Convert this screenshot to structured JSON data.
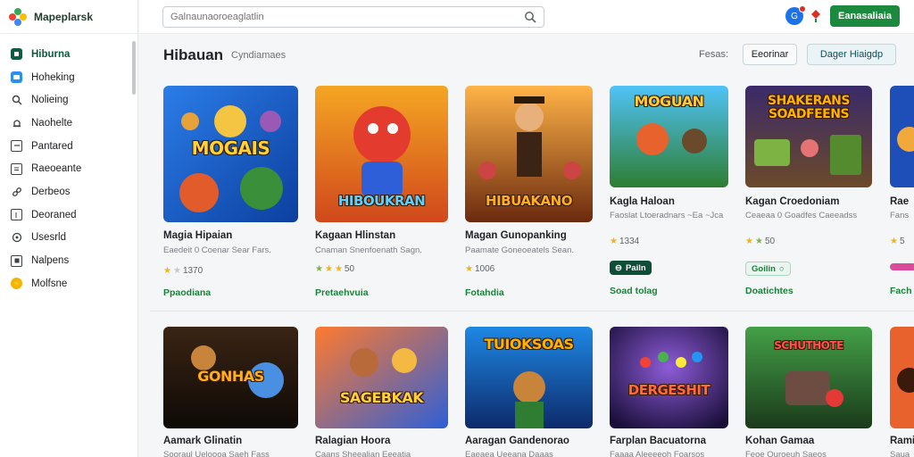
{
  "app": {
    "brand": "Mapeplarsk"
  },
  "sidebar": {
    "items": [
      {
        "label": "Hiburna",
        "icon": "home-icon",
        "active": true
      },
      {
        "label": "Hoheking",
        "icon": "chat-icon"
      },
      {
        "label": "Nolieing",
        "icon": "search-icon"
      },
      {
        "label": "Naohelte",
        "icon": "bell-icon"
      },
      {
        "label": "Pantared",
        "icon": "calendar-icon"
      },
      {
        "label": "Raeoeante",
        "icon": "document-icon"
      },
      {
        "label": "Derbeos",
        "icon": "link-icon"
      },
      {
        "label": "Deoraned",
        "icon": "bookmark-icon"
      },
      {
        "label": "Usesrld",
        "icon": "settings-icon"
      },
      {
        "label": "Nalpens",
        "icon": "grid-icon"
      },
      {
        "label": "Molfsne",
        "icon": "star-icon"
      }
    ]
  },
  "search": {
    "placeholder": "Galnaunaoroeaglatlin"
  },
  "topbar": {
    "cta_label": "Eanasaliaia",
    "avatar_initial": "G"
  },
  "header": {
    "title": "Hibauan",
    "subtitle": "Cyndiamaes",
    "sort_label": "Fesas:",
    "btn1": "Eeorinar",
    "btn2": "Dager Hiaigdp"
  },
  "row1": [
    {
      "thumb_title": "MOGAIS",
      "name": "Magia Hipaian",
      "desc": "Eaedeit 0 Coenar Sear Fars.",
      "rating": "1370",
      "link": "Ppaodiana"
    },
    {
      "thumb_title": "HIBOUKRAN",
      "name": "Kagaan Hlinstan",
      "desc": "Cnaman Snenfoenath Sagn.",
      "rating": "50",
      "link": "Pretaehvuia"
    },
    {
      "thumb_title": "HIBUAKANO",
      "name": "Magan Gunopanking",
      "desc": "Paamate Goneoeatels Sean.",
      "rating": "1006",
      "link": "Fotahdia"
    },
    {
      "thumb_title": "MOGUAN",
      "name": "Kagla Haloan",
      "desc": "Faoslat Ltoeradnars ~Ea ~Jca",
      "rating": "1334",
      "pill": "Pailn",
      "link": "Soad tolag"
    },
    {
      "thumb_title": "SHAKERANS SOADFEENS",
      "name": "Kagan Croedoniam",
      "desc": "Ceaeaa 0 Goadfes Caeeadss",
      "rating": "50",
      "pill": "Goilin",
      "link": "Doatichtes"
    },
    {
      "thumb_title": "",
      "name": "Rae",
      "desc": "Fans",
      "rating": "5",
      "link": "Fach"
    }
  ],
  "row2": [
    {
      "thumb_title": "GONHAS",
      "name": "Aamark Glinatin",
      "desc": "Sooraul Ueloooa Saeh Fass"
    },
    {
      "thumb_title": "SAGEBKAK",
      "name": "Ralagian Hoora",
      "desc": "Caans Sheealian Eeeatia"
    },
    {
      "thumb_title": "TUIOKSOAS",
      "name": "Aaragan Gandenorao",
      "desc": "Eaeaea Ueeana Daaas"
    },
    {
      "thumb_title": "DERGESHIT",
      "name": "Farplan Bacuatorna",
      "desc": "Faaaa Aleeeeoh Foarsos"
    },
    {
      "thumb_title": "SCHUTHOTE",
      "name": "Kohan Gamaa",
      "desc": "Feoe Ouroeuh Saeos"
    },
    {
      "thumb_title": "",
      "name": "Rami",
      "desc": "Saua"
    }
  ]
}
